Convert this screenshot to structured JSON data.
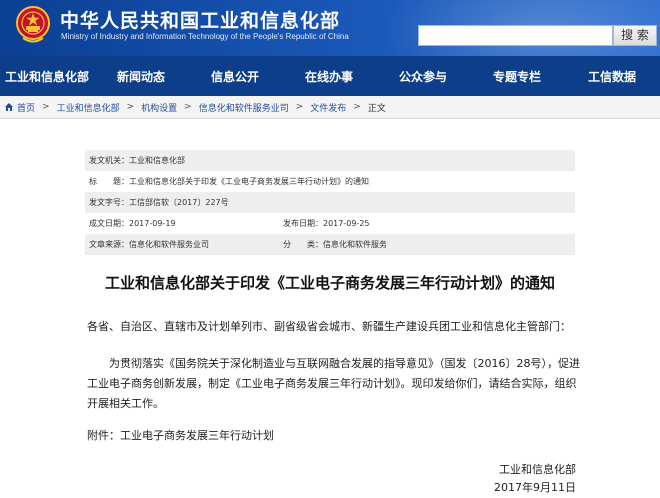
{
  "header": {
    "title": "中华人民共和国工业和信息化部",
    "subtitle": "Ministry of Industry and Information Technology of the People's Republic of China",
    "search_placeholder": "",
    "search_button": "搜 索",
    "colors": {
      "header_blue": "#1a58b8",
      "nav_blue": "#0d3e8a"
    }
  },
  "nav": {
    "items": [
      "工业和信息化部",
      "新闻动态",
      "信息公开",
      "在线办事",
      "公众参与",
      "专题专栏",
      "工信数据"
    ]
  },
  "breadcrumb": {
    "icon": "home-icon",
    "items": [
      "首页",
      "工业和信息化部",
      "机构设置",
      "信息化和软件服务业司",
      "文件发布",
      "正文"
    ]
  },
  "meta": {
    "issuer_label": "发文机关：",
    "issuer": "工业和信息化部",
    "subject_label": "标　　题：",
    "subject": "工业和信息化部关于印发《工业电子商务发展三年行动计划》的通知",
    "doc_no_label": "发文字号：",
    "doc_no": "工信部信软〔2017〕227号",
    "created_label": "成文日期：",
    "created": "2017-09-19",
    "published_label": "发布日期：",
    "published": "2017-09-25",
    "source_label": "文章来源：",
    "source": "信息化和软件服务业司",
    "category_label": "分　　类：",
    "category": "信息化和软件服务"
  },
  "article": {
    "title": "工业和信息化部关于印发《工业电子商务发展三年行动计划》的通知",
    "recipients": "各省、自治区、直辖市及计划单列市、副省级省会城市、新疆生产建设兵团工业和信息化主管部门：",
    "body": "为贯彻落实《国务院关于深化制造业与互联网融合发展的指导意见》（国发〔2016〕28号），促进工业电子商务创新发展，制定《工业电子商务发展三年行动计划》。现印发给你们，请结合实际，组织开展相关工作。",
    "attachment_label": "附件：",
    "attachment": "工业电子商务发展三年行动计划",
    "signature_org": "工业和信息化部",
    "signature_date": "2017年9月11日"
  }
}
